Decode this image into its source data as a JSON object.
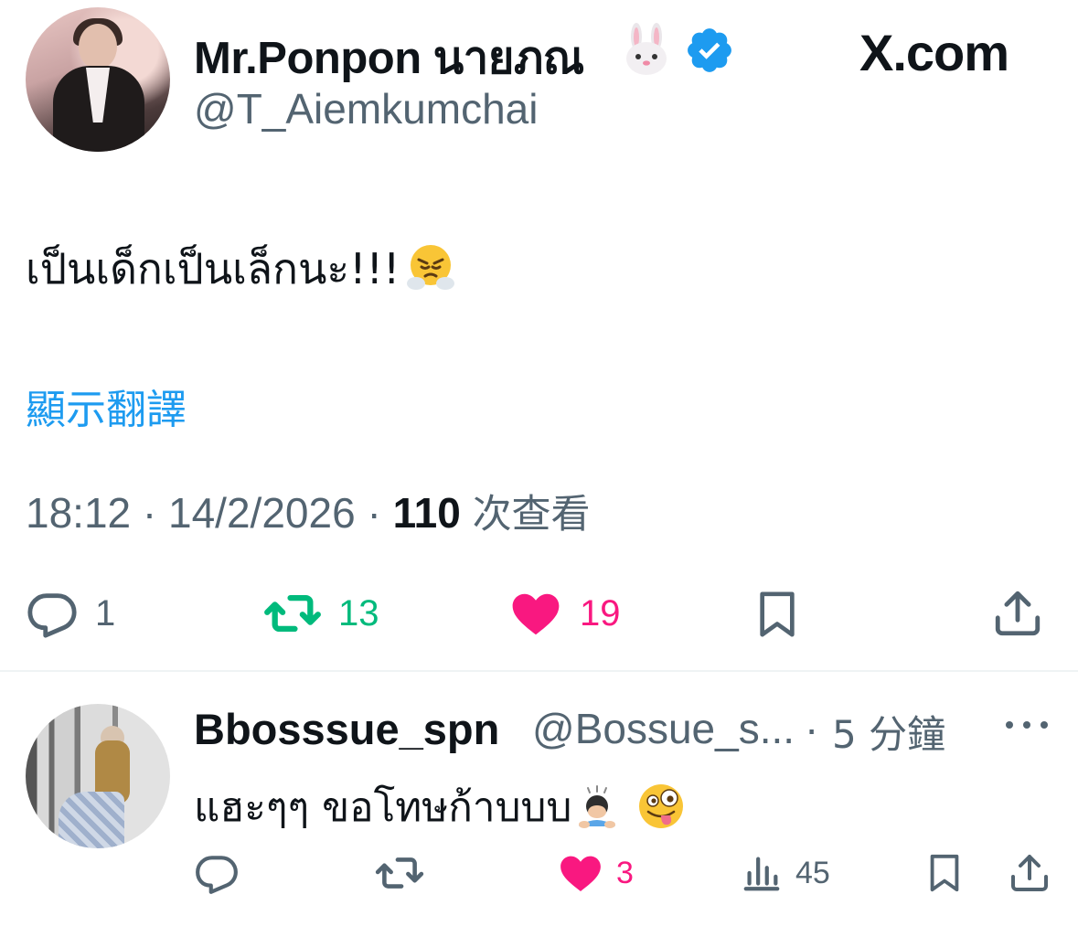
{
  "tweet": {
    "display_name": "Mr.Ponpon นายภณ",
    "handle": "@T_Aiemkumchai",
    "site_logo": "X.com",
    "text": "เป็นเด็กเป็นเล็กนะ!!!",
    "translate_label": "顯示翻譯",
    "time": "18:12",
    "date": "14/2/2026",
    "views_count": "110",
    "views_label": "次查看",
    "actions": {
      "replies": "1",
      "retweets": "13",
      "likes": "19"
    },
    "icons": [
      "rabbit-face-emoji",
      "verified-badge-icon",
      "face-with-steam-emoji",
      "x-logo-icon",
      "reply-icon",
      "retweet-icon",
      "heart-icon",
      "bookmark-icon",
      "share-icon"
    ]
  },
  "reply": {
    "display_name": "Bbosssue_spn",
    "handle": "@Bossue_s...",
    "separator": "·",
    "time_ago": "5 分鐘",
    "text": "แฮะๆๆ ขอโทษก้าบบบ",
    "actions": {
      "replies": "",
      "retweets": "",
      "likes": "3",
      "views": "45"
    }
  },
  "colors": {
    "text_primary": "#0f1419",
    "text_secondary": "#536471",
    "link": "#1d9bf0",
    "retweet_green": "#00ba7c",
    "like_pink": "#f91880",
    "verified_blue": "#1d9bf0"
  }
}
